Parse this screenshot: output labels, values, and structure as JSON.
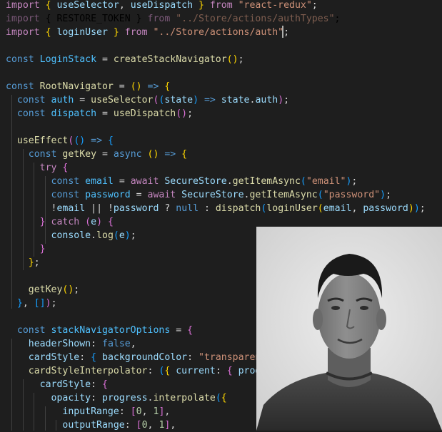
{
  "code": {
    "lines": [
      [
        [
          "kw",
          "import "
        ],
        [
          "b1",
          "{ "
        ],
        [
          "var",
          "useSelector"
        ],
        [
          "pl",
          ", "
        ],
        [
          "var",
          "useDispatch"
        ],
        [
          "b1",
          " } "
        ],
        [
          "kw",
          "from "
        ],
        [
          "str",
          "\"react-redux\""
        ],
        [
          "pl",
          ";"
        ]
      ],
      [
        [
          "kwd",
          "import "
        ],
        [
          "b1d",
          "{ "
        ],
        [
          "cnd",
          "RESTORE_TOKEN"
        ],
        [
          "b1d",
          " } "
        ],
        [
          "kwd",
          "from "
        ],
        [
          "strd",
          "\"../Store/actions/authTypes\""
        ],
        [
          "pld",
          ";"
        ]
      ],
      [
        [
          "kw",
          "import "
        ],
        [
          "b1",
          "{ "
        ],
        [
          "var",
          "loginUser"
        ],
        [
          "b1",
          " } "
        ],
        [
          "kw",
          "from "
        ],
        [
          "str",
          "\"../Store/actions/auth\""
        ],
        [
          "pl",
          ";"
        ]
      ],
      [],
      [
        [
          "dec",
          "const "
        ],
        [
          "cn",
          "LoginStack"
        ],
        [
          "pl",
          " = "
        ],
        [
          "fn",
          "createStackNavigator"
        ],
        [
          "b1",
          "()"
        ],
        [
          "pl",
          ";"
        ]
      ],
      [],
      [
        [
          "dec",
          "const "
        ],
        [
          "fn",
          "RootNavigator"
        ],
        [
          "pl",
          " = "
        ],
        [
          "b1",
          "()"
        ],
        [
          "dec",
          " => "
        ],
        [
          "b1",
          "{"
        ]
      ],
      [
        [
          "pl",
          "  "
        ],
        [
          "dec",
          "const "
        ],
        [
          "cn",
          "auth"
        ],
        [
          "pl",
          " = "
        ],
        [
          "fn",
          "useSelector"
        ],
        [
          "b2",
          "("
        ],
        [
          "b3",
          "("
        ],
        [
          "var",
          "state"
        ],
        [
          "b3",
          ")"
        ],
        [
          "dec",
          " => "
        ],
        [
          "var",
          "state"
        ],
        [
          "pl",
          "."
        ],
        [
          "var",
          "auth"
        ],
        [
          "b2",
          ")"
        ],
        [
          "pl",
          ";"
        ]
      ],
      [
        [
          "pl",
          "  "
        ],
        [
          "dec",
          "const "
        ],
        [
          "cn",
          "dispatch"
        ],
        [
          "pl",
          " = "
        ],
        [
          "fn",
          "useDispatch"
        ],
        [
          "b2",
          "()"
        ],
        [
          "pl",
          ";"
        ]
      ],
      [],
      [
        [
          "pl",
          "  "
        ],
        [
          "fn",
          "useEffect"
        ],
        [
          "b2",
          "("
        ],
        [
          "b3",
          "()"
        ],
        [
          "dec",
          " => "
        ],
        [
          "b3",
          "{"
        ]
      ],
      [
        [
          "pl",
          "    "
        ],
        [
          "dec",
          "const "
        ],
        [
          "fn",
          "getKey"
        ],
        [
          "pl",
          " = "
        ],
        [
          "dec",
          "async "
        ],
        [
          "b1",
          "()"
        ],
        [
          "dec",
          " => "
        ],
        [
          "b1",
          "{"
        ]
      ],
      [
        [
          "pl",
          "      "
        ],
        [
          "kw",
          "try "
        ],
        [
          "b2",
          "{"
        ]
      ],
      [
        [
          "pl",
          "        "
        ],
        [
          "dec",
          "const "
        ],
        [
          "cn",
          "email"
        ],
        [
          "pl",
          " = "
        ],
        [
          "kw",
          "await "
        ],
        [
          "var",
          "SecureStore"
        ],
        [
          "pl",
          "."
        ],
        [
          "fn",
          "getItemAsync"
        ],
        [
          "b3",
          "("
        ],
        [
          "str",
          "\"email\""
        ],
        [
          "b3",
          ")"
        ],
        [
          "pl",
          ";"
        ]
      ],
      [
        [
          "pl",
          "        "
        ],
        [
          "dec",
          "const "
        ],
        [
          "cn",
          "password"
        ],
        [
          "pl",
          " = "
        ],
        [
          "kw",
          "await "
        ],
        [
          "var",
          "SecureStore"
        ],
        [
          "pl",
          "."
        ],
        [
          "fn",
          "getItemAsync"
        ],
        [
          "b3",
          "("
        ],
        [
          "str",
          "\"password\""
        ],
        [
          "b3",
          ")"
        ],
        [
          "pl",
          ";"
        ]
      ],
      [
        [
          "pl",
          "        "
        ],
        [
          "pl",
          "!"
        ],
        [
          "var",
          "email"
        ],
        [
          "pl",
          " || !"
        ],
        [
          "var",
          "password"
        ],
        [
          "pl",
          " ? "
        ],
        [
          "dec",
          "null"
        ],
        [
          "pl",
          " : "
        ],
        [
          "fn",
          "dispatch"
        ],
        [
          "b3",
          "("
        ],
        [
          "fn",
          "loginUser"
        ],
        [
          "b1",
          "("
        ],
        [
          "var",
          "email"
        ],
        [
          "pl",
          ", "
        ],
        [
          "var",
          "password"
        ],
        [
          "b1",
          ")"
        ],
        [
          "b3",
          ")"
        ],
        [
          "pl",
          ";"
        ]
      ],
      [
        [
          "pl",
          "      "
        ],
        [
          "b2",
          "}"
        ],
        [
          "kw",
          " catch "
        ],
        [
          "b2",
          "("
        ],
        [
          "var",
          "e"
        ],
        [
          "b2",
          ") {"
        ]
      ],
      [
        [
          "pl",
          "        "
        ],
        [
          "var",
          "console"
        ],
        [
          "pl",
          "."
        ],
        [
          "fn",
          "log"
        ],
        [
          "b3",
          "("
        ],
        [
          "var",
          "e"
        ],
        [
          "b3",
          ")"
        ],
        [
          "pl",
          ";"
        ]
      ],
      [
        [
          "pl",
          "      "
        ],
        [
          "b2",
          "}"
        ]
      ],
      [
        [
          "pl",
          "    "
        ],
        [
          "b1",
          "}"
        ],
        [
          "pl",
          ";"
        ]
      ],
      [],
      [
        [
          "pl",
          "    "
        ],
        [
          "fn",
          "getKey"
        ],
        [
          "b1",
          "()"
        ],
        [
          "pl",
          ";"
        ]
      ],
      [
        [
          "pl",
          "  "
        ],
        [
          "b3",
          "}"
        ],
        [
          "pl",
          ", "
        ],
        [
          "b3",
          "[]"
        ],
        [
          "b2",
          ")"
        ],
        [
          "pl",
          ";"
        ]
      ],
      [],
      [
        [
          "pl",
          "  "
        ],
        [
          "dec",
          "const "
        ],
        [
          "cn",
          "stackNavigatorOptions"
        ],
        [
          "pl",
          " = "
        ],
        [
          "b2",
          "{"
        ]
      ],
      [
        [
          "pl",
          "    "
        ],
        [
          "var",
          "headerShown"
        ],
        [
          "pl",
          ": "
        ],
        [
          "dec",
          "false"
        ],
        [
          "pl",
          ","
        ]
      ],
      [
        [
          "pl",
          "    "
        ],
        [
          "var",
          "cardStyle"
        ],
        [
          "pl",
          ": "
        ],
        [
          "b3",
          "{ "
        ],
        [
          "var",
          "backgroundColor"
        ],
        [
          "pl",
          ": "
        ],
        [
          "str",
          "\"transparent\""
        ],
        [
          "b3",
          " }"
        ],
        [
          "pl",
          ","
        ]
      ],
      [
        [
          "pl",
          "    "
        ],
        [
          "fn",
          "cardStyleInterpolator"
        ],
        [
          "pl",
          ": "
        ],
        [
          "b3",
          "("
        ],
        [
          "b1",
          "{ "
        ],
        [
          "var",
          "current"
        ],
        [
          "pl",
          ": "
        ],
        [
          "b2",
          "{ "
        ],
        [
          "var",
          "progress"
        ],
        [
          "b2",
          " }"
        ],
        [
          "b1",
          " }"
        ],
        [
          "b3",
          ")"
        ],
        [
          "dec",
          " => "
        ],
        [
          "b3",
          "("
        ],
        [
          "b1",
          "{"
        ]
      ],
      [
        [
          "pl",
          "      "
        ],
        [
          "var",
          "cardStyle"
        ],
        [
          "pl",
          ": "
        ],
        [
          "b2",
          "{"
        ]
      ],
      [
        [
          "pl",
          "        "
        ],
        [
          "var",
          "opacity"
        ],
        [
          "pl",
          ": "
        ],
        [
          "var",
          "progress"
        ],
        [
          "pl",
          "."
        ],
        [
          "fn",
          "interpolate"
        ],
        [
          "b3",
          "("
        ],
        [
          "b1",
          "{"
        ]
      ],
      [
        [
          "pl",
          "          "
        ],
        [
          "var",
          "inputRange"
        ],
        [
          "pl",
          ": "
        ],
        [
          "b2",
          "["
        ],
        [
          "num",
          "0"
        ],
        [
          "pl",
          ", "
        ],
        [
          "num",
          "1"
        ],
        [
          "b2",
          "]"
        ],
        [
          "pl",
          ","
        ]
      ],
      [
        [
          "pl",
          "          "
        ],
        [
          "var",
          "outputRange"
        ],
        [
          "pl",
          ": "
        ],
        [
          "b2",
          "["
        ],
        [
          "num",
          "0"
        ],
        [
          "pl",
          ", "
        ],
        [
          "num",
          "1"
        ],
        [
          "b2",
          "]"
        ],
        [
          "pl",
          ","
        ]
      ]
    ]
  }
}
